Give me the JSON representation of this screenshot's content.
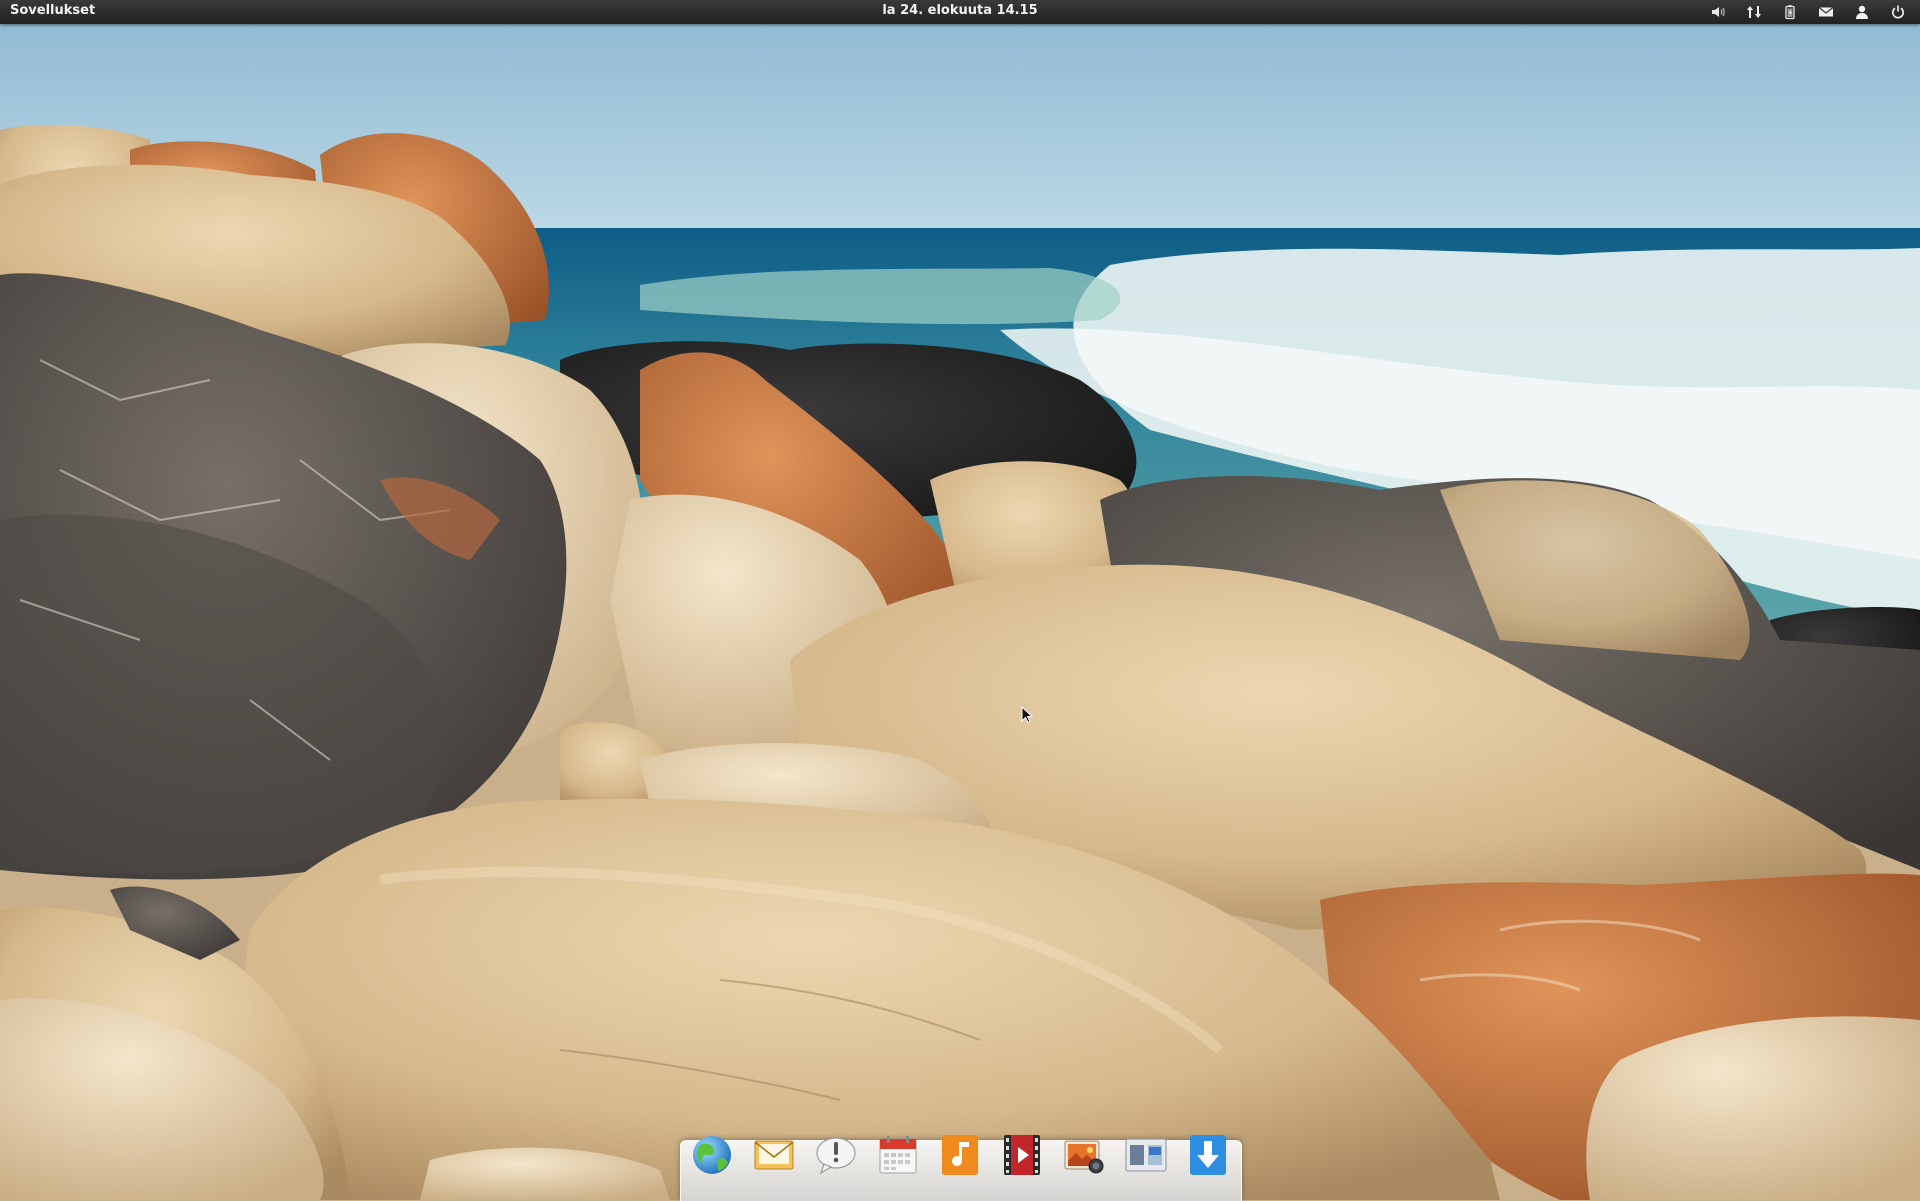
{
  "panel": {
    "apps_label": "Sovellukset",
    "clock": "la 24. elokuuta 14.15",
    "indicators": [
      {
        "icon": "volume-icon"
      },
      {
        "icon": "network-icon"
      },
      {
        "icon": "battery-icon"
      },
      {
        "icon": "mail-icon"
      },
      {
        "icon": "user-icon"
      },
      {
        "icon": "power-icon"
      }
    ]
  },
  "dock": {
    "items": [
      {
        "icon": "web-browser-icon"
      },
      {
        "icon": "mail-client-icon"
      },
      {
        "icon": "messaging-icon"
      },
      {
        "icon": "calendar-icon"
      },
      {
        "icon": "music-player-icon"
      },
      {
        "icon": "video-player-icon"
      },
      {
        "icon": "photos-icon"
      },
      {
        "icon": "workspace-switcher-icon"
      },
      {
        "icon": "software-center-icon"
      }
    ]
  },
  "wallpaper": {
    "sky_color": "#a9cde0",
    "sea_color": "#1f6f93",
    "foam_color": "#e8f3f3",
    "rock_colors": [
      "#d8c09a",
      "#c68450",
      "#5a544e",
      "#2c2b2b",
      "#c26a3a"
    ]
  }
}
